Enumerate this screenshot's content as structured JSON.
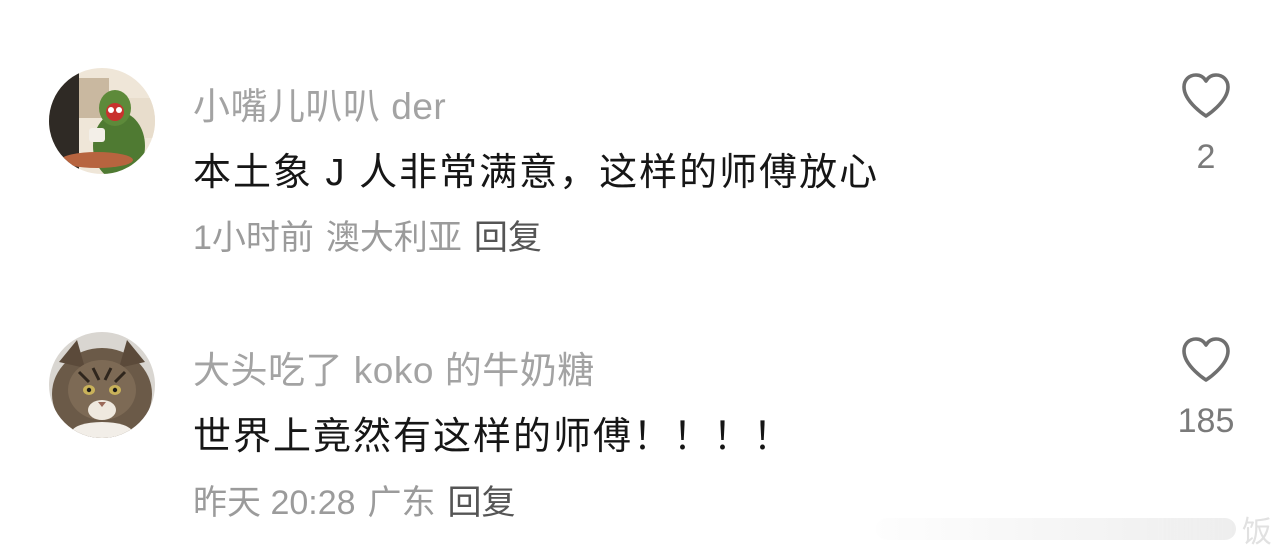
{
  "comments": [
    {
      "username": "小嘴儿叭叭 der",
      "text": "本土象 J 人非常满意，这样的师傅放心",
      "time": "1小时前",
      "location": "澳大利亚",
      "reply_label": "回复",
      "like_count": "2",
      "avatar": "cartoon-avatar"
    },
    {
      "username": "大头吃了 koko 的牛奶糖",
      "text": "世界上竟然有这样的师傅！！！！",
      "time": "昨天 20:28",
      "location": "广东",
      "reply_label": "回复",
      "like_count": "185",
      "avatar": "cat-avatar"
    }
  ],
  "icons": {
    "like": "heart-outline-icon"
  },
  "watermark": {
    "text": "饭"
  },
  "colors": {
    "username": "#a3a3a3",
    "text": "#161616",
    "meta": "#9b9b9b",
    "reply": "#555555",
    "like_icon": "#6f6f6f"
  }
}
